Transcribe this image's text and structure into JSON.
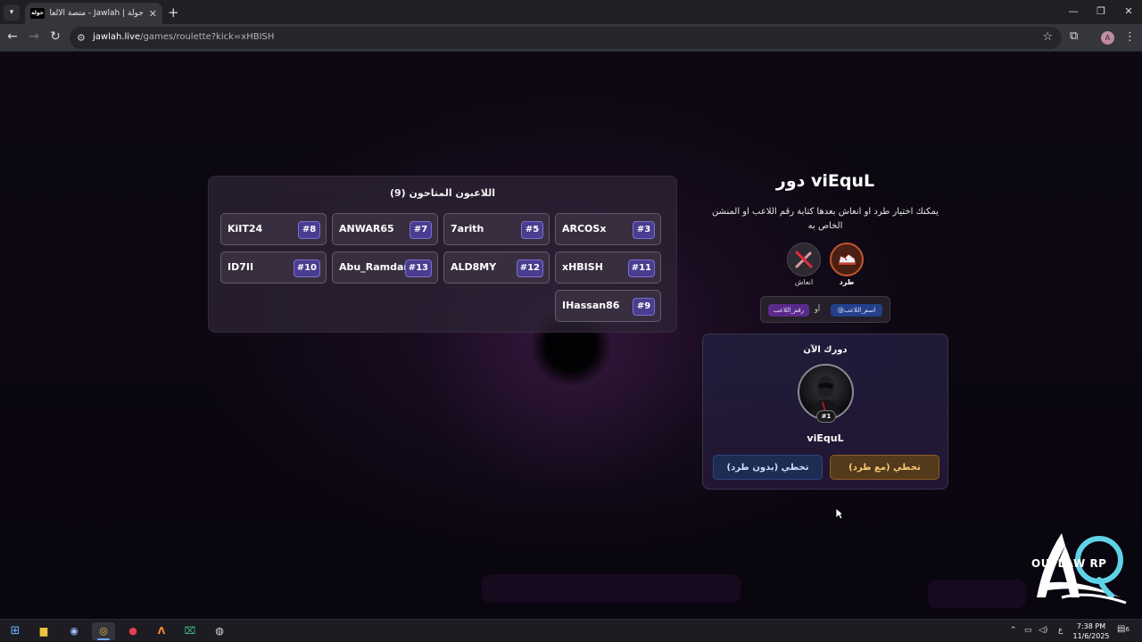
{
  "browser": {
    "tab": {
      "favicon_text": "جولة",
      "title": "جولة | Jawlah - منصة الألعاب الت..."
    },
    "new_tab_symbol": "+",
    "url": {
      "host": "jawlah.live",
      "path": "/games/roulette?kick=xHBISH"
    },
    "profile_initial": "A"
  },
  "players_panel": {
    "title": "اللاعبون المتاحون (9)",
    "players": [
      {
        "name": "ARCOSx",
        "num": "#3"
      },
      {
        "name": "7arith",
        "num": "#5"
      },
      {
        "name": "ANWAR65",
        "num": "#7"
      },
      {
        "name": "KiIT24",
        "num": "#8"
      },
      {
        "name": "xHBISH",
        "num": "#11"
      },
      {
        "name": "ALD8MY",
        "num": "#12"
      },
      {
        "name": "Abu_Ramdan",
        "num": "#13"
      },
      {
        "name": "ID7II",
        "num": "#10"
      },
      {
        "name": "IHassan86",
        "num": "#9"
      }
    ]
  },
  "turn": {
    "title": "دور viEquL",
    "description": "يمكنك اختيار طرد او انعاش بعدها كتابة رقم اللاعب او المنشن الخاص به",
    "actions": {
      "kick_label": "طرد",
      "revive_label": "انعاش"
    },
    "hint": {
      "name_pill": "@اسم_اللاعب",
      "or": "أو",
      "number_pill": "رقم_اللاعب"
    }
  },
  "current_turn": {
    "heading": "دورك الآن",
    "badge": "#1",
    "player": "viEquL",
    "skip_with_kick": "تخطي (مع طرد)",
    "skip_without_kick": "تخطي (بدون طرد)"
  },
  "logo": {
    "text": "OUTLAW RP"
  },
  "taskbar": {
    "tray_lang": "ع",
    "time": "7:38 PM",
    "date": "11/6/2025",
    "notif_count": "6"
  }
}
